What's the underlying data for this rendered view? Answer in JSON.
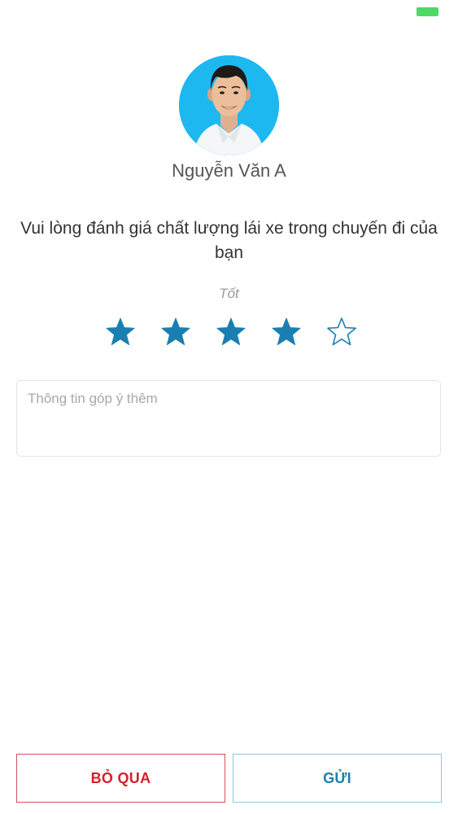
{
  "status_bar": {
    "battery_color": "#4cd964"
  },
  "driver": {
    "name": "Nguyễn Văn A",
    "avatar_icon": "driver-avatar-photo"
  },
  "rating": {
    "prompt": "Vui lòng đánh giá chất lượng lái xe trong chuyến đi của bạn",
    "label": "Tốt",
    "value": 4,
    "max": 5,
    "star_color": "#1a7fb0"
  },
  "feedback": {
    "placeholder": "Thông tin góp ý thêm",
    "value": ""
  },
  "actions": {
    "skip_label": "BỎ QUA",
    "send_label": "GỬI",
    "skip_color": "#d4202a",
    "send_color": "#1a7fb0"
  }
}
